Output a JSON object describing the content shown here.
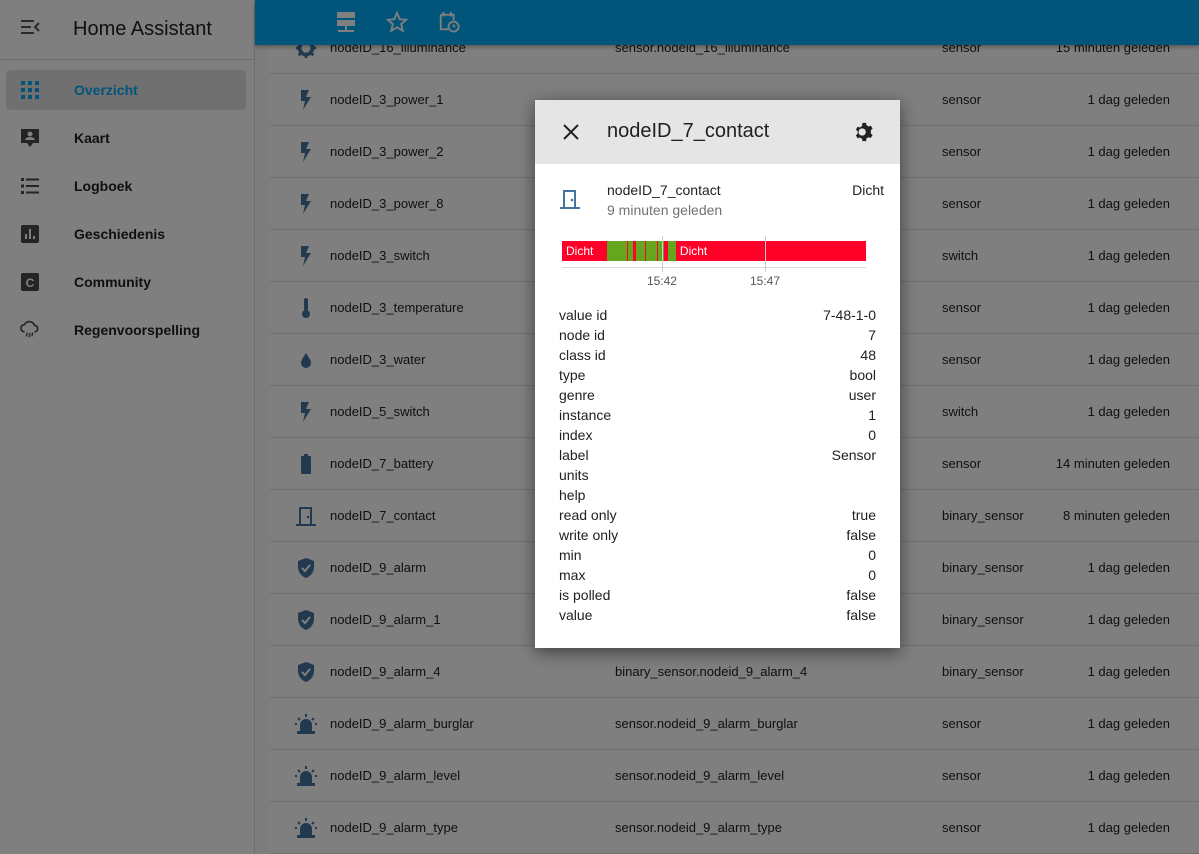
{
  "app": {
    "title": "Home Assistant",
    "header_color": "#03a9f4"
  },
  "sidebar": {
    "items": [
      {
        "label": "Overzicht",
        "icon": "view-dashboard-icon",
        "active": true
      },
      {
        "label": "Kaart",
        "icon": "account-location-icon"
      },
      {
        "label": "Logboek",
        "icon": "format-list-bulleted-icon"
      },
      {
        "label": "Geschiedenis",
        "icon": "chart-box-icon"
      },
      {
        "label": "Community",
        "icon": "community-icon"
      },
      {
        "label": "Regenvoorspelling",
        "icon": "weather-rainy-icon"
      }
    ]
  },
  "topbar": {
    "icons": [
      "server-network-icon",
      "star-icon",
      "calendar-clock-icon"
    ]
  },
  "entities": [
    {
      "name": "nodeID_16_illuminance",
      "entity_id": "sensor.nodeid_16_illuminance",
      "domain": "sensor",
      "changed": "15 minuten geleden",
      "icon": "gear"
    },
    {
      "name": "nodeID_3_power_1",
      "entity_id": "",
      "domain": "sensor",
      "changed": "1 dag geleden",
      "icon": "flash"
    },
    {
      "name": "nodeID_3_power_2",
      "entity_id": "",
      "domain": "sensor",
      "changed": "1 dag geleden",
      "icon": "flash"
    },
    {
      "name": "nodeID_3_power_8",
      "entity_id": "",
      "domain": "sensor",
      "changed": "1 dag geleden",
      "icon": "flash"
    },
    {
      "name": "nodeID_3_switch",
      "entity_id": "",
      "domain": "switch",
      "changed": "1 dag geleden",
      "icon": "flash"
    },
    {
      "name": "nodeID_3_temperature",
      "entity_id": "",
      "domain": "sensor",
      "changed": "1 dag geleden",
      "icon": "thermometer"
    },
    {
      "name": "nodeID_3_water",
      "entity_id": "",
      "domain": "sensor",
      "changed": "1 dag geleden",
      "icon": "water"
    },
    {
      "name": "nodeID_5_switch",
      "entity_id": "",
      "domain": "switch",
      "changed": "1 dag geleden",
      "icon": "flash"
    },
    {
      "name": "nodeID_7_battery",
      "entity_id": "",
      "domain": "sensor",
      "changed": "14 minuten geleden",
      "icon": "battery"
    },
    {
      "name": "nodeID_7_contact",
      "entity_id": "",
      "domain": "binary_sensor",
      "changed": "8 minuten geleden",
      "icon": "door"
    },
    {
      "name": "nodeID_9_alarm",
      "entity_id": "",
      "domain": "binary_sensor",
      "changed": "1 dag geleden",
      "icon": "shield"
    },
    {
      "name": "nodeID_9_alarm_1",
      "entity_id": "",
      "domain": "binary_sensor",
      "changed": "1 dag geleden",
      "icon": "shield"
    },
    {
      "name": "nodeID_9_alarm_4",
      "entity_id": "binary_sensor.nodeid_9_alarm_4",
      "domain": "binary_sensor",
      "changed": "1 dag geleden",
      "icon": "shield"
    },
    {
      "name": "nodeID_9_alarm_burglar",
      "entity_id": "sensor.nodeid_9_alarm_burglar",
      "domain": "sensor",
      "changed": "1 dag geleden",
      "icon": "alarm-light"
    },
    {
      "name": "nodeID_9_alarm_level",
      "entity_id": "sensor.nodeid_9_alarm_level",
      "domain": "sensor",
      "changed": "1 dag geleden",
      "icon": "alarm-light"
    },
    {
      "name": "nodeID_9_alarm_type",
      "entity_id": "sensor.nodeid_9_alarm_type",
      "domain": "sensor",
      "changed": "1 dag geleden",
      "icon": "alarm-light"
    }
  ],
  "dialog": {
    "title": "nodeID_7_contact",
    "entity_name": "nodeID_7_contact",
    "last_changed": "9 minuten geleden",
    "state": "Dicht",
    "timeline": {
      "start": "15:37:09",
      "end": "15:51:54",
      "ticks": [
        "15:42",
        "15:47"
      ],
      "colors": {
        "closed": "#ff0029",
        "open": "#66a61e"
      },
      "segments": [
        {
          "from": "15:37:09",
          "to": "15:39:20",
          "state": "closed",
          "label": "Dicht"
        },
        {
          "from": "15:39:20",
          "to": "15:40:18",
          "state": "open"
        },
        {
          "from": "15:40:18",
          "to": "15:40:21",
          "state": "closed"
        },
        {
          "from": "15:40:21",
          "to": "15:40:36",
          "state": "open"
        },
        {
          "from": "15:40:36",
          "to": "15:40:44",
          "state": "closed"
        },
        {
          "from": "15:40:44",
          "to": "15:41:12",
          "state": "open"
        },
        {
          "from": "15:41:12",
          "to": "15:41:15",
          "state": "closed"
        },
        {
          "from": "15:41:15",
          "to": "15:41:45",
          "state": "open"
        },
        {
          "from": "15:41:45",
          "to": "15:41:48",
          "state": "closed"
        },
        {
          "from": "15:41:48",
          "to": "15:42:06",
          "state": "open"
        },
        {
          "from": "15:42:06",
          "to": "15:42:17",
          "state": "closed"
        },
        {
          "from": "15:42:17",
          "to": "15:42:41",
          "state": "open"
        },
        {
          "from": "15:42:41",
          "to": "15:51:54",
          "state": "closed",
          "label": "Dicht"
        }
      ]
    },
    "attributes": [
      {
        "key": "value id",
        "value": "7-48-1-0"
      },
      {
        "key": "node id",
        "value": "7"
      },
      {
        "key": "class id",
        "value": "48"
      },
      {
        "key": "type",
        "value": "bool"
      },
      {
        "key": "genre",
        "value": "user"
      },
      {
        "key": "instance",
        "value": "1"
      },
      {
        "key": "index",
        "value": "0"
      },
      {
        "key": "label",
        "value": "Sensor"
      },
      {
        "key": "units",
        "value": ""
      },
      {
        "key": "help",
        "value": ""
      },
      {
        "key": "read only",
        "value": "true"
      },
      {
        "key": "write only",
        "value": "false"
      },
      {
        "key": "min",
        "value": "0"
      },
      {
        "key": "max",
        "value": "0"
      },
      {
        "key": "is polled",
        "value": "false"
      },
      {
        "key": "value",
        "value": "false"
      }
    ]
  }
}
